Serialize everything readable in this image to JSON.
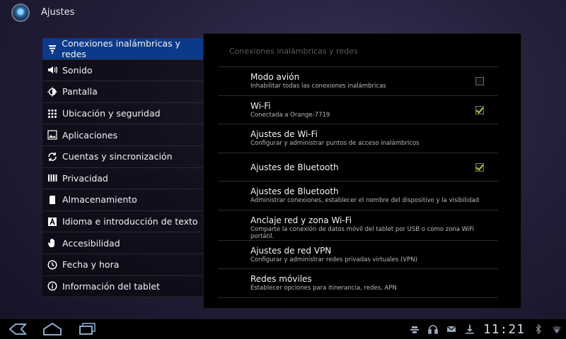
{
  "app": {
    "title": "Ajustes"
  },
  "sidebar": {
    "items": [
      {
        "label": "Conexiones inalámbricas y redes",
        "icon": "wireless-icon",
        "selected": true
      },
      {
        "label": "Sonido",
        "icon": "speaker-icon",
        "selected": false
      },
      {
        "label": "Pantalla",
        "icon": "brightness-icon",
        "selected": false
      },
      {
        "label": "Ubicación y seguridad",
        "icon": "grid-icon",
        "selected": false
      },
      {
        "label": "Aplicaciones",
        "icon": "apps-icon",
        "selected": false
      },
      {
        "label": "Cuentas y sincronización",
        "icon": "sync-icon",
        "selected": false
      },
      {
        "label": "Privacidad",
        "icon": "privacy-icon",
        "selected": false
      },
      {
        "label": "Almacenamiento",
        "icon": "storage-icon",
        "selected": false
      },
      {
        "label": "Idioma e introducción de texto",
        "icon": "language-icon",
        "selected": false
      },
      {
        "label": "Accesibilidad",
        "icon": "hand-icon",
        "selected": false
      },
      {
        "label": "Fecha y hora",
        "icon": "clock-icon",
        "selected": false
      },
      {
        "label": "Información del tablet",
        "icon": "info-icon",
        "selected": false
      }
    ]
  },
  "panel": {
    "header": "Conexiones inalámbricas y redes",
    "rows": [
      {
        "title": "Modo avión",
        "subtitle": "Inhabilitar todas las conexiones inalámbricas",
        "checkbox": true,
        "checked": false
      },
      {
        "title": "Wi-Fi",
        "subtitle": "Conectada a Orange-7719",
        "checkbox": true,
        "checked": true
      },
      {
        "title": "Ajustes de Wi-Fi",
        "subtitle": "Configurar y administrar puntos de acceso inalámbricos",
        "checkbox": false
      },
      {
        "title": "Ajustes de Bluetooth",
        "subtitle": "",
        "checkbox": true,
        "checked": true
      },
      {
        "title": "Ajustes de Bluetooth",
        "subtitle": "Administrar conexiones, establecer el nombre del dispositivo y la visibilidad",
        "checkbox": false
      },
      {
        "title": "Anclaje red y zona Wi-Fi",
        "subtitle": "Comparte la conexión de datos móvil del tablet por USB o como zona WiFi portátil.",
        "checkbox": false
      },
      {
        "title": "Ajustes de red VPN",
        "subtitle": "Configurar y administrar redes privadas virtuales (VPN)",
        "checkbox": false
      },
      {
        "title": "Redes móviles",
        "subtitle": "Establecer opciones para itinerancia, redes, APN",
        "checkbox": false
      }
    ]
  },
  "statusbar": {
    "time": "11:21"
  },
  "colors": {
    "accent": "#0c3a8a",
    "check": "#9bd22e"
  }
}
